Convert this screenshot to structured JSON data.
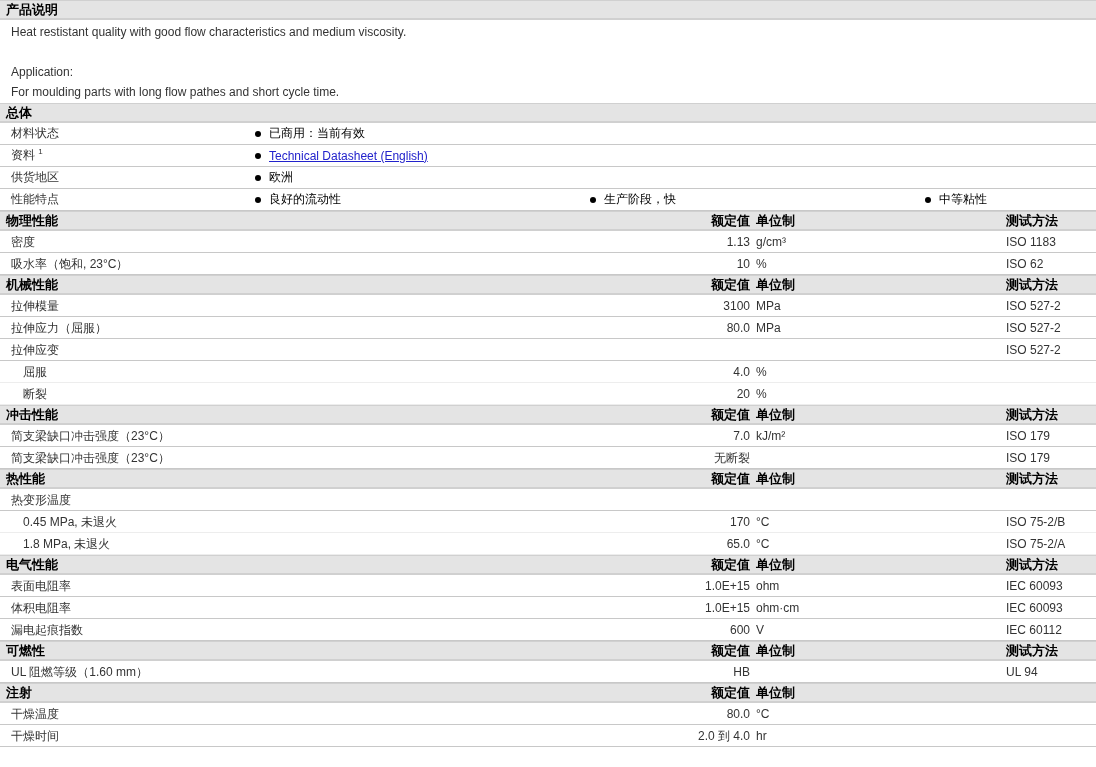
{
  "sections": [
    {
      "kind": "description",
      "title": "产品说明",
      "blocks": [
        [
          "Heat restistant quality with good flow characteristics and medium viscosity."
        ],
        [
          "Application:",
          "For moulding parts with long flow pathes and short cycle time."
        ]
      ]
    },
    {
      "kind": "general",
      "title": "总体",
      "rows": [
        {
          "label": "材料状态",
          "values": [
            {
              "kind": "text",
              "text": "已商用：当前有效"
            }
          ]
        },
        {
          "label": "资料 $^{1}$",
          "values": [
            {
              "kind": "link",
              "text": "Technical Datasheet (English)"
            }
          ]
        },
        {
          "label": "供货地区",
          "values": [
            {
              "kind": "text",
              "text": "欧洲"
            }
          ]
        },
        {
          "label": "性能特点",
          "values": [
            {
              "kind": "text",
              "text": "良好的流动性"
            },
            {
              "kind": "text",
              "text": "生产阶段，快"
            },
            {
              "kind": "text",
              "text": "中等粘性"
            }
          ]
        }
      ]
    },
    {
      "kind": "properties",
      "title": "物理性能",
      "headers": {
        "value": "额定值",
        "unit": "单位制",
        "method": "测试方法"
      },
      "rows": [
        {
          "kind": "row",
          "label": "密度",
          "value": "1.13",
          "unit": "g/cm³",
          "method": "ISO 1183"
        },
        {
          "kind": "row",
          "label": "吸水率（饱和, 23°C）",
          "value": "10",
          "unit": "%",
          "method": "ISO 62"
        }
      ]
    },
    {
      "kind": "properties",
      "title": "机械性能",
      "headers": {
        "value": "额定值",
        "unit": "单位制",
        "method": "测试方法"
      },
      "rows": [
        {
          "kind": "row",
          "label": "拉伸模量",
          "value": "3100",
          "unit": "MPa",
          "method": "ISO 527-2"
        },
        {
          "kind": "row",
          "label": "拉伸应力（屈服）",
          "value": "80.0",
          "unit": "MPa",
          "method": "ISO 527-2"
        },
        {
          "kind": "row",
          "label": "拉伸应变",
          "method": "ISO 527-2"
        },
        {
          "kind": "sub",
          "label": "屈服",
          "value": "4.0",
          "unit": "%"
        },
        {
          "kind": "sub",
          "label": "断裂",
          "value": "20",
          "unit": "%"
        }
      ]
    },
    {
      "kind": "properties",
      "title": "冲击性能",
      "headers": {
        "value": "额定值",
        "unit": "单位制",
        "method": "测试方法"
      },
      "rows": [
        {
          "kind": "row",
          "label": "简支梁缺口冲击强度（23°C）",
          "value": "7.0",
          "unit": "kJ/m²",
          "method": "ISO 179"
        },
        {
          "kind": "row",
          "label": "简支梁缺口冲击强度（23°C）",
          "value": "无断裂",
          "method": "ISO 179"
        }
      ]
    },
    {
      "kind": "properties",
      "title": "热性能",
      "headers": {
        "value": "额定值",
        "unit": "单位制",
        "method": "测试方法"
      },
      "rows": [
        {
          "kind": "row",
          "label": "热变形温度"
        },
        {
          "kind": "sub",
          "label": "0.45 MPa, 未退火",
          "value": "170",
          "unit": "°C",
          "method": "ISO 75-2/B"
        },
        {
          "kind": "sub",
          "label": "1.8 MPa, 未退火",
          "value": "65.0",
          "unit": "°C",
          "method": "ISO 75-2/A"
        }
      ]
    },
    {
      "kind": "properties",
      "title": "电气性能",
      "headers": {
        "value": "额定值",
        "unit": "单位制",
        "method": "测试方法"
      },
      "rows": [
        {
          "kind": "row",
          "label": "表面电阻率",
          "value": "1.0E+15",
          "unit": "ohm",
          "method": "IEC 60093"
        },
        {
          "kind": "row",
          "label": "体积电阻率",
          "value": "1.0E+15",
          "unit": "ohm·cm",
          "method": "IEC 60093"
        },
        {
          "kind": "row",
          "label": "漏电起痕指数",
          "value": "600",
          "unit": "V",
          "method": "IEC 60112"
        }
      ]
    },
    {
      "kind": "properties",
      "title": "可燃性",
      "headers": {
        "value": "额定值",
        "unit": "单位制",
        "method": "测试方法"
      },
      "rows": [
        {
          "kind": "row",
          "label": "UL 阻燃等级（1.60 mm）",
          "value": "HB",
          "method": "UL 94"
        }
      ]
    },
    {
      "kind": "properties",
      "title": "注射",
      "headers": {
        "value": "额定值",
        "unit": "单位制"
      },
      "rows": [
        {
          "kind": "row",
          "label": "干燥温度",
          "value": "80.0",
          "unit": "°C"
        },
        {
          "kind": "row",
          "label": "干燥时间",
          "value": "2.0 到 4.0",
          "unit": "hr"
        }
      ]
    }
  ]
}
